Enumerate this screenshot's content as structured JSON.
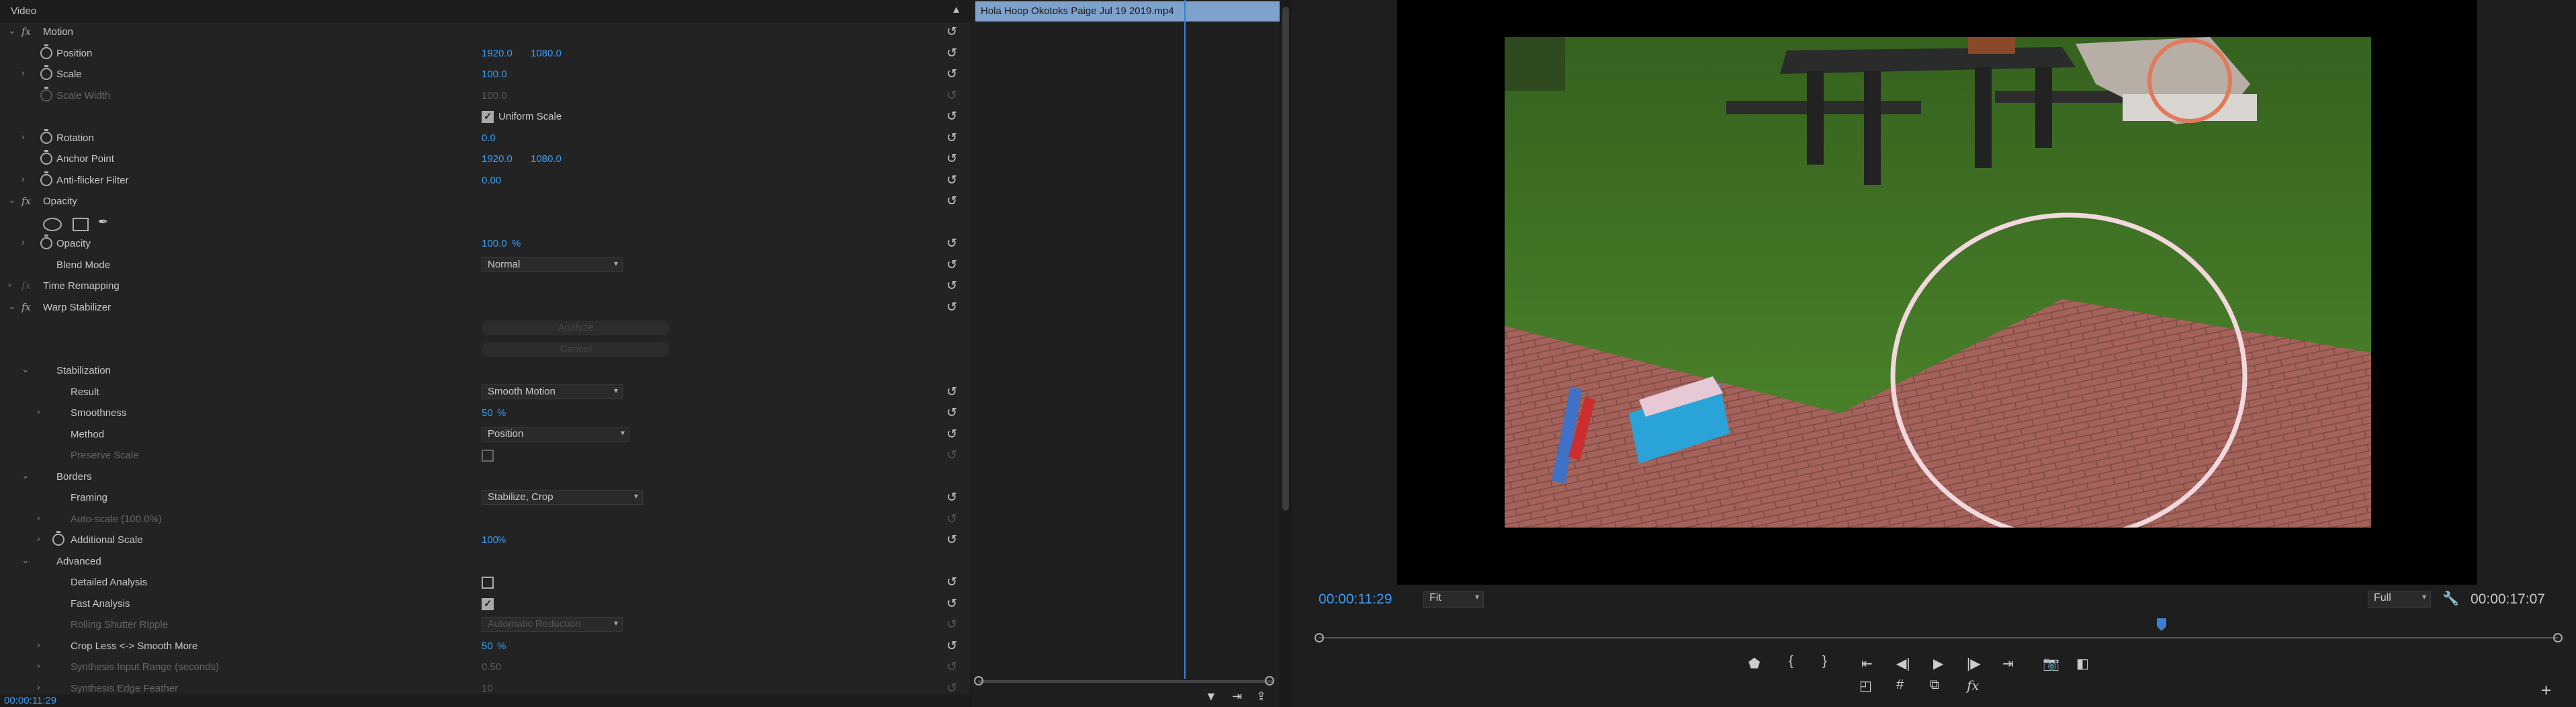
{
  "effects_panel": {
    "header": "Video",
    "rows": [
      {
        "kind": "fx",
        "label": "Motion",
        "level": 0
      },
      {
        "kind": "prop",
        "label": "Position",
        "stopwatch": true,
        "v1": "1920.0",
        "v2": "1080.0"
      },
      {
        "kind": "prop",
        "label": "Scale",
        "stopwatch": true,
        "v1": "100.0",
        "expand": true
      },
      {
        "kind": "prop",
        "label": "Scale Width",
        "stopwatch": true,
        "v1": "100.0",
        "disabled": true
      },
      {
        "kind": "check",
        "label": "Uniform Scale",
        "checked": true
      },
      {
        "kind": "prop",
        "label": "Rotation",
        "stopwatch": true,
        "v1": "0.0",
        "expand": true
      },
      {
        "kind": "prop",
        "label": "Anchor Point",
        "stopwatch": true,
        "v1": "1920.0",
        "v2": "1080.0"
      },
      {
        "kind": "prop",
        "label": "Anti-flicker Filter",
        "stopwatch": true,
        "v1": "0.00",
        "expand": true
      },
      {
        "kind": "fx",
        "label": "Opacity"
      },
      {
        "kind": "masks"
      },
      {
        "kind": "prop",
        "label": "Opacity",
        "stopwatch": true,
        "v1": "100.0",
        "unit": "%",
        "expand": true
      },
      {
        "kind": "dropdown",
        "label": "Blend Mode",
        "value": "Normal"
      },
      {
        "kind": "fx",
        "label": "Time Remapping",
        "collapsed": true,
        "disabled": true
      },
      {
        "kind": "fx",
        "label": "Warp Stabilizer"
      },
      {
        "kind": "button",
        "label": "Analyze"
      },
      {
        "kind": "button",
        "label": "Cancel"
      },
      {
        "kind": "group",
        "label": "Stabilization"
      },
      {
        "kind": "dropdown",
        "label": "Result",
        "value": "Smooth Motion",
        "indent": 2
      },
      {
        "kind": "prop",
        "label": "Smoothness",
        "v1": "50",
        "unit": "%",
        "indent": 2,
        "expand": true
      },
      {
        "kind": "dropdown",
        "label": "Method",
        "value": "Position",
        "indent": 2
      },
      {
        "kind": "check",
        "label": "Preserve Scale",
        "checked": false,
        "indent": 2,
        "disabled": true
      },
      {
        "kind": "group",
        "label": "Borders"
      },
      {
        "kind": "dropdown",
        "label": "Framing",
        "value": "Stabilize, Crop",
        "indent": 2
      },
      {
        "kind": "prop",
        "label": "Auto-scale (100.0%)",
        "indent": 2,
        "disabled": true,
        "expand": true
      },
      {
        "kind": "prop",
        "label": "Additional Scale",
        "stopwatch": true,
        "v1": "100",
        "unit": "%",
        "indent": 2,
        "expand": true
      },
      {
        "kind": "group",
        "label": "Advanced"
      },
      {
        "kind": "check",
        "label": "Detailed Analysis",
        "checked": false,
        "indent": 2
      },
      {
        "kind": "check",
        "label": "Fast Analysis",
        "checked": true,
        "indent": 2
      },
      {
        "kind": "dropdown",
        "label": "Rolling Shutter Ripple",
        "value": "Automatic Reduction",
        "indent": 2,
        "disabled": true
      },
      {
        "kind": "prop",
        "label": "Crop Less <-> Smooth More",
        "v1": "50",
        "unit": "%",
        "indent": 2,
        "expand": true
      },
      {
        "kind": "prop",
        "label": "Synthesis Input Range (seconds)",
        "v1": "0.50",
        "indent": 2,
        "disabled": true,
        "expand": true
      },
      {
        "kind": "prop",
        "label": "Synthesis Edge Feather",
        "v1": "10",
        "indent": 2,
        "disabled": true,
        "expand": true
      }
    ],
    "timecode": "00:00:11:29"
  },
  "clip": {
    "name": "Hola Hoop Okotoks Paige Jul 19 2019.mp4"
  },
  "monitor": {
    "current_time": "00:00:11:29",
    "zoom": "Fit",
    "resolution": "Full",
    "duration": "00:00:17:07",
    "playhead_fraction": 0.68
  },
  "colors": {
    "accent": "#3a9cf5",
    "clip": "#7fa2cc"
  }
}
